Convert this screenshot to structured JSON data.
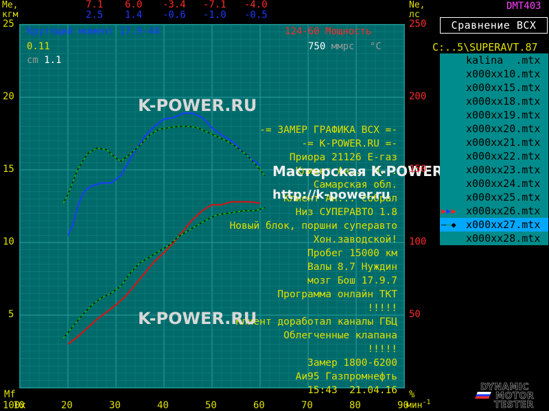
{
  "header": {
    "me_label": "Me,",
    "me_unit": "кгм",
    "row1_values": [
      "7.1",
      "6.0",
      "-3.4",
      "-7.1",
      "-4.0"
    ],
    "row2_values": [
      "2.5",
      "1.4",
      "-0.6",
      "-1.0",
      "-0.5"
    ],
    "ne_label": "Ne,",
    "ne_unit": "лс",
    "device": "DMT403"
  },
  "legend": {
    "torque_label": "Крутящий момент",
    "torque_value": "17.9-44",
    "power_value": "124-60",
    "power_label": "Мощность",
    "coef1": "0.11",
    "cm_label": "cm",
    "coef2": "1.1",
    "pressure_value": "750",
    "pressure_unit": "ммрс",
    "temp_unit": "°C"
  },
  "right_panel": {
    "compare_label": "Сравнение  ВСХ",
    "path": "C:..5\\SUPERAVT.87",
    "files": [
      "kalina  .mtx",
      "x000xx10.mtx",
      "x000xx15.mtx",
      "x000xx18.mtx",
      "x000xx19.mtx",
      "x000xx20.mtx",
      "x000xx21.mtx",
      "x000xx22.mtx",
      "x000xx23.mtx",
      "x000xx24.mtx",
      "x000xx25.mtx",
      "x000xx26.mtx",
      "x000xx27.mtx",
      "x000xx28.mtx"
    ],
    "selected_index": 12
  },
  "info_text": [
    "-= ЗАМЕР ГРАФИКА ВСХ =-",
    "-= K-POWER.RU =-",
    "Приора 21126 Е-газ",
    "Клиент Ан... М...",
    "Самарская обл.",
    "Клиент Ан... собрал",
    "Низ СУПЕРАВТО 1.8",
    "Новый блок, поршни суперавто",
    "Хон.заводской!",
    "Пробег 15000 км",
    "Валы 8.7 Нуждин",
    "мозг Бош 17.9.7",
    "Программа онлайн ТКТ",
    "!!!!!",
    "Клиент доработал каналы ГБЦ",
    "Облегченные клапана",
    "!!!!!",
    "Замер 1800-6200",
    "Аи95 Газпромнефть",
    "15:43  21.04.16"
  ],
  "watermarks": {
    "top": "K-POWER.RU",
    "middle_title": "Мастерская K-POWER",
    "middle_url": "http://k-power.ru",
    "bottom": "K-POWER.RU"
  },
  "logo": {
    "line1": "DYNAMIC",
    "line2": "MOTOR",
    "line3": "TESTER"
  },
  "axis_labels": {
    "mf": "Mf",
    "x_prefix": "100x",
    "percent": "%",
    "rpm_unit": "мин",
    "rpm_exp": "-1"
  },
  "chart_data": {
    "type": "line",
    "x_label": "100x мин-1",
    "xlim": [
      10,
      90
    ],
    "x_ticks": [
      10,
      20,
      30,
      40,
      50,
      60,
      70,
      80,
      90
    ],
    "y_left_label": "Me, кгм",
    "y_left_lim": [
      0,
      25
    ],
    "y_left_ticks": [
      5,
      10,
      15,
      20,
      25
    ],
    "y_right_label": "Ne, лс",
    "y_right_lim": [
      0,
      250
    ],
    "y_right_ticks": [
      50,
      100,
      150,
      200,
      250
    ],
    "grid": true,
    "series": [
      {
        "name": "Крутящий момент",
        "axis": "left",
        "color": "#1a3cff",
        "x": [
          20,
          21,
          22,
          23,
          24,
          25,
          27,
          29,
          31,
          32,
          34,
          36,
          38,
          40,
          42,
          44,
          46,
          48,
          50,
          52,
          54,
          56,
          58,
          60
        ],
        "y": [
          10.5,
          11.2,
          12.4,
          13.3,
          13.7,
          13.9,
          14.1,
          14.1,
          14.6,
          15.2,
          16.3,
          17.3,
          18.0,
          18.5,
          18.6,
          18.9,
          18.9,
          18.6,
          17.9,
          17.4,
          17.0,
          16.4,
          15.8,
          15.3
        ]
      },
      {
        "name": "Мощность",
        "axis": "right",
        "color": "#e01010",
        "x": [
          20,
          22,
          24,
          26,
          28,
          30,
          32,
          34,
          36,
          38,
          40,
          42,
          44,
          46,
          48,
          50,
          52,
          54,
          56,
          58,
          60
        ],
        "y": [
          30,
          35,
          41,
          47,
          52,
          57,
          63,
          71,
          79,
          87,
          93,
          100,
          108,
          116,
          122,
          126,
          126,
          128,
          128,
          128,
          127
        ]
      },
      {
        "name": "x000xx27.mtx",
        "axis": "left",
        "color": "#00c000",
        "dashed": true,
        "x": [
          19,
          20,
          22,
          24,
          26,
          28,
          30,
          31,
          33,
          35,
          37,
          39,
          41,
          43,
          45,
          47,
          49,
          51,
          53,
          55,
          57,
          59,
          61
        ],
        "y": [
          12.7,
          13.3,
          15.0,
          16.1,
          16.5,
          16.4,
          15.8,
          15.6,
          16.1,
          16.7,
          17.4,
          17.8,
          17.9,
          18.0,
          18.0,
          17.9,
          17.6,
          17.3,
          17.0,
          16.6,
          16.1,
          15.4,
          14.6
        ]
      },
      {
        "name": "x000xx27.mtx",
        "axis": "right",
        "color": "#00c000",
        "dashed": true,
        "x": [
          19,
          21,
          23,
          25,
          27,
          29,
          31,
          33,
          35,
          37,
          39,
          41,
          43,
          45,
          47,
          49,
          51,
          53,
          55,
          57,
          59,
          61
        ],
        "y": [
          34,
          42,
          50,
          57,
          62,
          65,
          70,
          79,
          86,
          90,
          94,
          98,
          104,
          108,
          112,
          116,
          119,
          120,
          121,
          122,
          122,
          124
        ]
      }
    ]
  }
}
